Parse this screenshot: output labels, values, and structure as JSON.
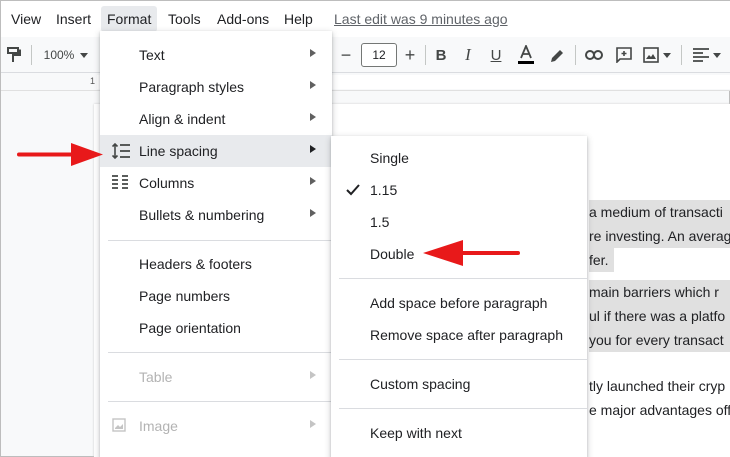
{
  "menubar": {
    "items": [
      "View",
      "Insert",
      "Format",
      "Tools",
      "Add-ons",
      "Help"
    ],
    "last_edit": "Last edit was 9 minutes ago"
  },
  "toolbar": {
    "zoom": "100%",
    "font_size": "12",
    "decrease_label": "−",
    "increase_label": "+"
  },
  "ruler": {
    "number": "1"
  },
  "format_menu": {
    "items": [
      {
        "label": "Text",
        "submenu": true
      },
      {
        "label": "Paragraph styles",
        "submenu": true
      },
      {
        "label": "Align & indent",
        "submenu": true
      },
      {
        "label": "Line spacing",
        "submenu": true,
        "icon": "line-spacing-icon",
        "highlighted": true
      },
      {
        "label": "Columns",
        "submenu": true,
        "icon": "columns-icon"
      },
      {
        "label": "Bullets & numbering",
        "submenu": true
      },
      {
        "label": "Headers & footers"
      },
      {
        "label": "Page numbers"
      },
      {
        "label": "Page orientation"
      },
      {
        "label": "Table",
        "submenu": true,
        "disabled": true
      },
      {
        "label": "Image",
        "submenu": true,
        "disabled": true,
        "icon": "image-icon"
      }
    ]
  },
  "spacing_menu": {
    "items": [
      {
        "label": "Single"
      },
      {
        "label": "1.15",
        "checked": true
      },
      {
        "label": "1.5"
      },
      {
        "label": "Double"
      },
      {
        "label": "Add space before paragraph"
      },
      {
        "label": "Remove space after paragraph"
      },
      {
        "label": "Custom spacing"
      },
      {
        "label": "Keep with next"
      }
    ]
  },
  "document": {
    "lines": [
      "a medium of transacti",
      "re investing. An averag",
      "fer.",
      "main barriers which r",
      "ul if there was a platfo",
      "you for every transact",
      "tly launched their cryp",
      "e major advantages off"
    ]
  },
  "colors": {
    "annotation_arrow": "#e8191a",
    "menu_highlight": "#e8eaed",
    "selection": "#e0e0e0"
  }
}
